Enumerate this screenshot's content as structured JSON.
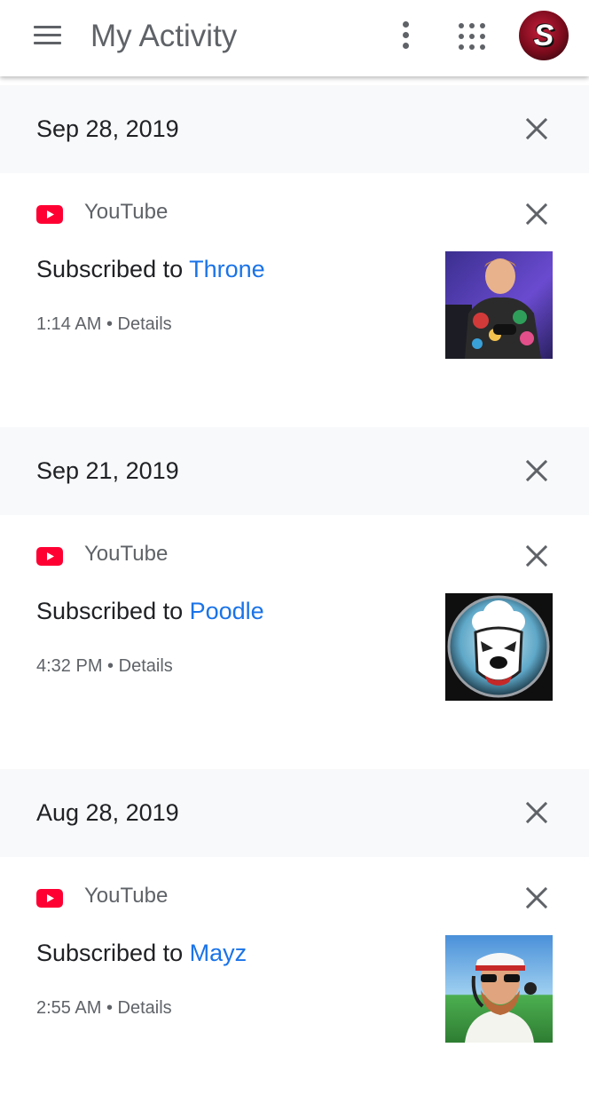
{
  "app_bar": {
    "title": "My Activity",
    "menu_icon": "hamburger-menu-icon",
    "more_icon": "more-vert-icon",
    "apps_icon": "apps-grid-icon",
    "avatar_letter": "S"
  },
  "groups": [
    {
      "date": "Sep 28, 2019",
      "item": {
        "product": "YouTube",
        "action": "Subscribed to",
        "channel": "Throne",
        "time": "1:14 AM",
        "separator": "•",
        "details": "Details"
      }
    },
    {
      "date": "Sep 21, 2019",
      "item": {
        "product": "YouTube",
        "action": "Subscribed to",
        "channel": "Poodle",
        "time": "4:32 PM",
        "separator": "•",
        "details": "Details"
      }
    },
    {
      "date": "Aug 28, 2019",
      "item": {
        "product": "YouTube",
        "action": "Subscribed to",
        "channel": "Mayz",
        "time": "2:55 AM",
        "separator": "•",
        "details": "Details"
      }
    }
  ],
  "colors": {
    "link": "#1a73e8",
    "youtube_red": "#ff0033",
    "header_bg": "#f8f9fa",
    "secondary_text": "#5f6368"
  }
}
